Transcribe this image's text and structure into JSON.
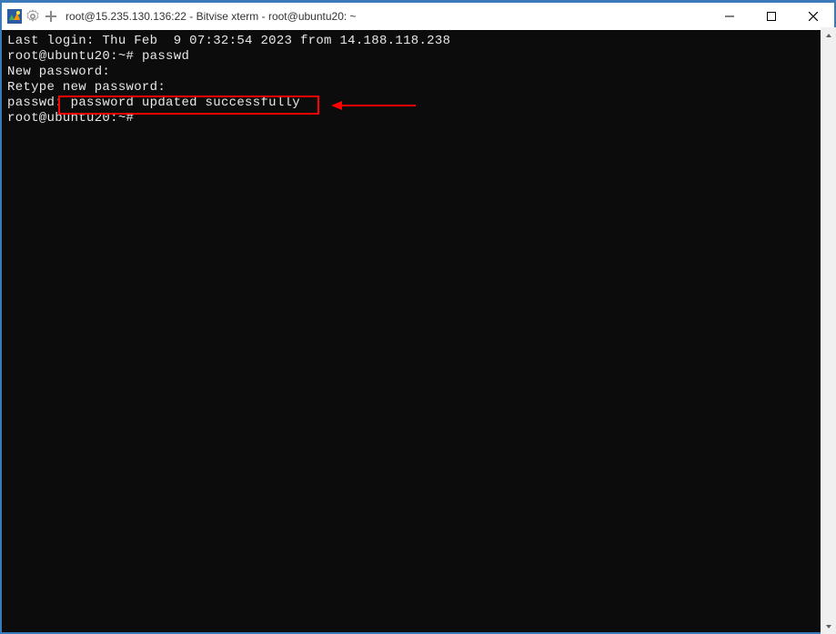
{
  "window": {
    "title": "root@15.235.130.136:22 - Bitvise xterm - root@ubuntu20: ~"
  },
  "terminal": {
    "line1": "Last login: Thu Feb  9 07:32:54 2023 from 14.188.118.238",
    "line2_prompt": "root@ubuntu20:~# ",
    "line2_cmd": "passwd",
    "line3": "New password:",
    "line4": "Retype new password:",
    "line5_prefix": "passwd: ",
    "line5_msg": "password updated successfully",
    "line6_prompt": "root@ubuntu20:~#"
  },
  "annotation": {
    "highlighted_text": "password updated successfully"
  }
}
